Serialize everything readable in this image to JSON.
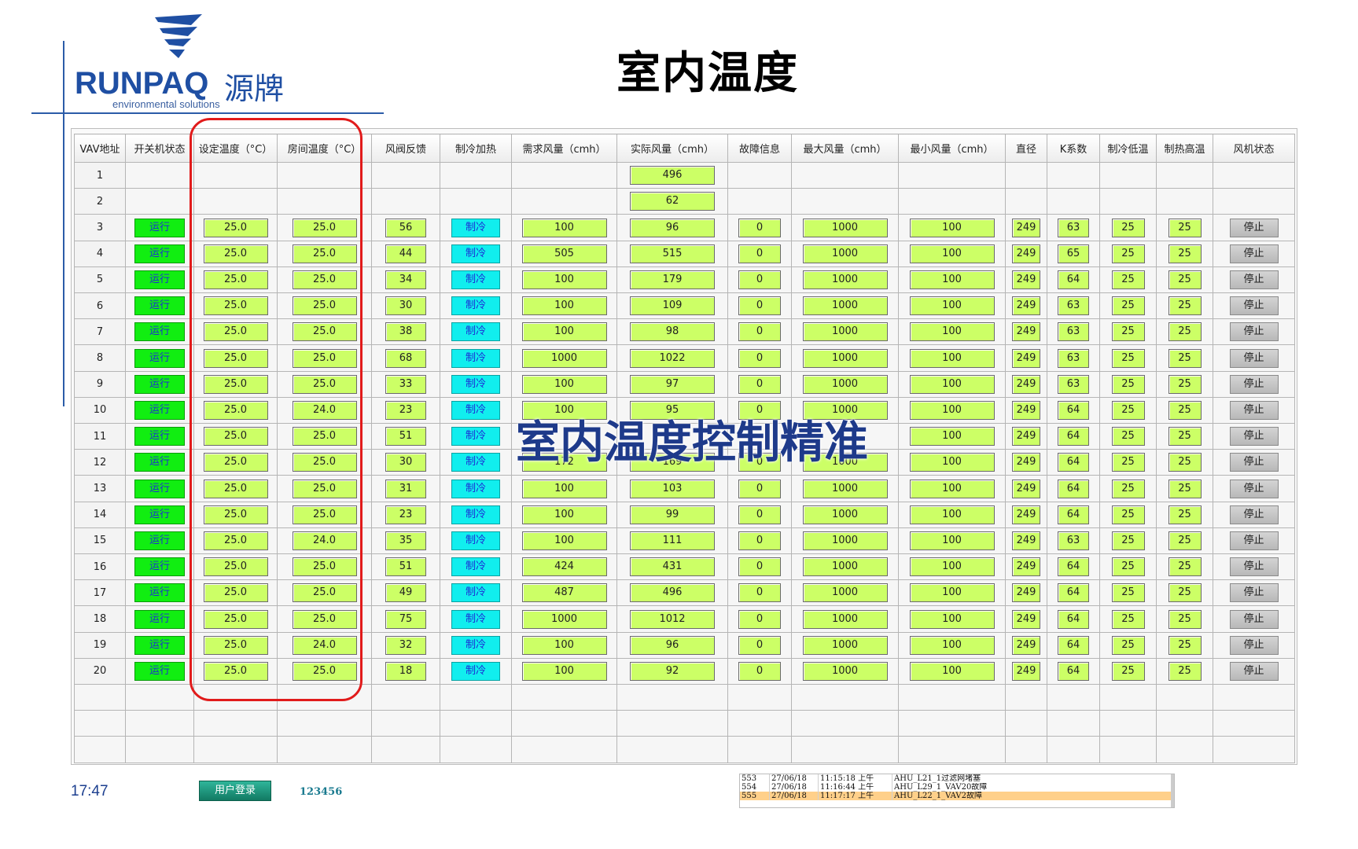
{
  "page": {
    "title": "室内温度",
    "overlay": "室内温度控制精准"
  },
  "logo": {
    "brand": "RUNPAQ",
    "brand_cn": "源牌",
    "tagline": "environmental solutions"
  },
  "table": {
    "headers": [
      "VAV地址",
      "开关机状态",
      "设定温度（°C）",
      "房间温度（°C）",
      "风阀反馈",
      "制冷加热",
      "需求风量（cmh）",
      "实际风量（cmh）",
      "故障信息",
      "最大风量（cmh）",
      "最小风量（cmh）",
      "直径",
      "K系数",
      "制冷低温",
      "制热高温",
      "风机状态"
    ],
    "partial_rows": [
      {
        "addr": "1",
        "actual": "496"
      },
      {
        "addr": "2",
        "actual": "62"
      }
    ],
    "rows": [
      {
        "addr": "3",
        "state": "运行",
        "set": "25.0",
        "room": "25.0",
        "damper": "56",
        "mode": "制冷",
        "req": "100",
        "actual": "96",
        "fault": "0",
        "max": "1000",
        "min": "100",
        "dia": "249",
        "k": "63",
        "cool_low": "25",
        "heat_high": "25",
        "fan": "停止"
      },
      {
        "addr": "4",
        "state": "运行",
        "set": "25.0",
        "room": "25.0",
        "damper": "44",
        "mode": "制冷",
        "req": "505",
        "actual": "515",
        "fault": "0",
        "max": "1000",
        "min": "100",
        "dia": "249",
        "k": "65",
        "cool_low": "25",
        "heat_high": "25",
        "fan": "停止"
      },
      {
        "addr": "5",
        "state": "运行",
        "set": "25.0",
        "room": "25.0",
        "damper": "34",
        "mode": "制冷",
        "req": "100",
        "actual": "179",
        "fault": "0",
        "max": "1000",
        "min": "100",
        "dia": "249",
        "k": "64",
        "cool_low": "25",
        "heat_high": "25",
        "fan": "停止"
      },
      {
        "addr": "6",
        "state": "运行",
        "set": "25.0",
        "room": "25.0",
        "damper": "30",
        "mode": "制冷",
        "req": "100",
        "actual": "109",
        "fault": "0",
        "max": "1000",
        "min": "100",
        "dia": "249",
        "k": "63",
        "cool_low": "25",
        "heat_high": "25",
        "fan": "停止"
      },
      {
        "addr": "7",
        "state": "运行",
        "set": "25.0",
        "room": "25.0",
        "damper": "38",
        "mode": "制冷",
        "req": "100",
        "actual": "98",
        "fault": "0",
        "max": "1000",
        "min": "100",
        "dia": "249",
        "k": "63",
        "cool_low": "25",
        "heat_high": "25",
        "fan": "停止"
      },
      {
        "addr": "8",
        "state": "运行",
        "set": "25.0",
        "room": "25.0",
        "damper": "68",
        "mode": "制冷",
        "req": "1000",
        "actual": "1022",
        "fault": "0",
        "max": "1000",
        "min": "100",
        "dia": "249",
        "k": "63",
        "cool_low": "25",
        "heat_high": "25",
        "fan": "停止"
      },
      {
        "addr": "9",
        "state": "运行",
        "set": "25.0",
        "room": "25.0",
        "damper": "33",
        "mode": "制冷",
        "req": "100",
        "actual": "97",
        "fault": "0",
        "max": "1000",
        "min": "100",
        "dia": "249",
        "k": "63",
        "cool_low": "25",
        "heat_high": "25",
        "fan": "停止"
      },
      {
        "addr": "10",
        "state": "运行",
        "set": "25.0",
        "room": "24.0",
        "damper": "23",
        "mode": "制冷",
        "req": "100",
        "actual": "95",
        "fault": "0",
        "max": "1000",
        "min": "100",
        "dia": "249",
        "k": "64",
        "cool_low": "25",
        "heat_high": "25",
        "fan": "停止"
      },
      {
        "addr": "11",
        "state": "运行",
        "set": "25.0",
        "room": "25.0",
        "damper": "51",
        "mode": "制冷",
        "req": "",
        "actual": "",
        "fault": "",
        "max": "",
        "min": "100",
        "dia": "249",
        "k": "64",
        "cool_low": "25",
        "heat_high": "25",
        "fan": "停止"
      },
      {
        "addr": "12",
        "state": "运行",
        "set": "25.0",
        "room": "25.0",
        "damper": "30",
        "mode": "制冷",
        "req": "172",
        "actual": "169",
        "fault": "0",
        "max": "1000",
        "min": "100",
        "dia": "249",
        "k": "64",
        "cool_low": "25",
        "heat_high": "25",
        "fan": "停止"
      },
      {
        "addr": "13",
        "state": "运行",
        "set": "25.0",
        "room": "25.0",
        "damper": "31",
        "mode": "制冷",
        "req": "100",
        "actual": "103",
        "fault": "0",
        "max": "1000",
        "min": "100",
        "dia": "249",
        "k": "64",
        "cool_low": "25",
        "heat_high": "25",
        "fan": "停止"
      },
      {
        "addr": "14",
        "state": "运行",
        "set": "25.0",
        "room": "25.0",
        "damper": "23",
        "mode": "制冷",
        "req": "100",
        "actual": "99",
        "fault": "0",
        "max": "1000",
        "min": "100",
        "dia": "249",
        "k": "64",
        "cool_low": "25",
        "heat_high": "25",
        "fan": "停止"
      },
      {
        "addr": "15",
        "state": "运行",
        "set": "25.0",
        "room": "24.0",
        "damper": "35",
        "mode": "制冷",
        "req": "100",
        "actual": "111",
        "fault": "0",
        "max": "1000",
        "min": "100",
        "dia": "249",
        "k": "63",
        "cool_low": "25",
        "heat_high": "25",
        "fan": "停止"
      },
      {
        "addr": "16",
        "state": "运行",
        "set": "25.0",
        "room": "25.0",
        "damper": "51",
        "mode": "制冷",
        "req": "424",
        "actual": "431",
        "fault": "0",
        "max": "1000",
        "min": "100",
        "dia": "249",
        "k": "64",
        "cool_low": "25",
        "heat_high": "25",
        "fan": "停止"
      },
      {
        "addr": "17",
        "state": "运行",
        "set": "25.0",
        "room": "25.0",
        "damper": "49",
        "mode": "制冷",
        "req": "487",
        "actual": "496",
        "fault": "0",
        "max": "1000",
        "min": "100",
        "dia": "249",
        "k": "64",
        "cool_low": "25",
        "heat_high": "25",
        "fan": "停止"
      },
      {
        "addr": "18",
        "state": "运行",
        "set": "25.0",
        "room": "25.0",
        "damper": "75",
        "mode": "制冷",
        "req": "1000",
        "actual": "1012",
        "fault": "0",
        "max": "1000",
        "min": "100",
        "dia": "249",
        "k": "64",
        "cool_low": "25",
        "heat_high": "25",
        "fan": "停止"
      },
      {
        "addr": "19",
        "state": "运行",
        "set": "25.0",
        "room": "24.0",
        "damper": "32",
        "mode": "制冷",
        "req": "100",
        "actual": "96",
        "fault": "0",
        "max": "1000",
        "min": "100",
        "dia": "249",
        "k": "64",
        "cool_low": "25",
        "heat_high": "25",
        "fan": "停止"
      },
      {
        "addr": "20",
        "state": "运行",
        "set": "25.0",
        "room": "25.0",
        "damper": "18",
        "mode": "制冷",
        "req": "100",
        "actual": "92",
        "fault": "0",
        "max": "1000",
        "min": "100",
        "dia": "249",
        "k": "64",
        "cool_low": "25",
        "heat_high": "25",
        "fan": "停止"
      }
    ],
    "empty_rows": 3
  },
  "footer": {
    "time": "17:47",
    "login_label": "用户登录",
    "user_code": "123456"
  },
  "log": {
    "rows": [
      {
        "id": "553",
        "date": "27/06/18",
        "time": "11:15:18 上午",
        "msg": "AHU_L21_1过滤网堵塞",
        "selected": false
      },
      {
        "id": "554",
        "date": "27/06/18",
        "time": "11:16:44 上午",
        "msg": "AHU_L29_1_VAV20故障",
        "selected": false
      },
      {
        "id": "555",
        "date": "27/06/18",
        "time": "11:17:17 上午",
        "msg": "AHU_L22_1_VAV2故障",
        "selected": true
      }
    ]
  },
  "colors": {
    "value_box": "#ccff66",
    "run": "#11ee11",
    "cool": "#11eeee",
    "highlight": "#e11b1b",
    "brand": "#1f4fa3"
  }
}
